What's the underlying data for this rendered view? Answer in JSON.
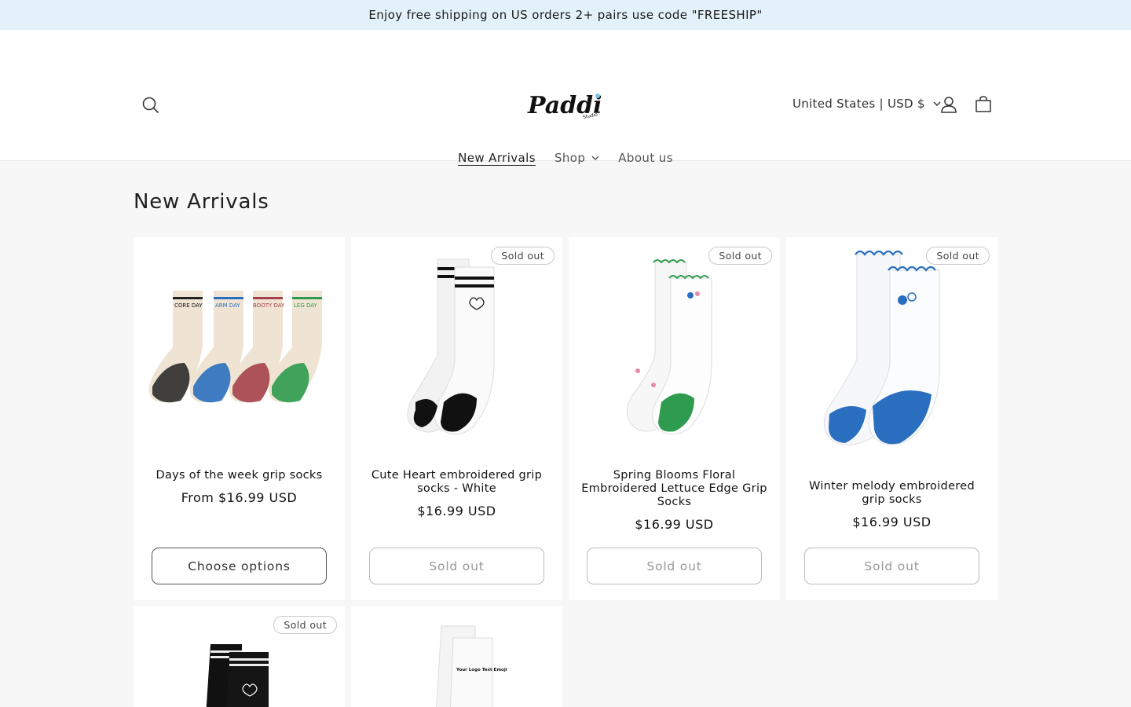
{
  "announcement": "Enjoy free shipping on US orders 2+ pairs use code \"FREESHIP\"",
  "header": {
    "logo_text": "Paddi",
    "logo_sub": "Studio",
    "locale": "United States | USD $"
  },
  "nav": [
    {
      "label": "New Arrivals",
      "active": true
    },
    {
      "label": "Shop",
      "dropdown": true
    },
    {
      "label": "About us"
    }
  ],
  "page_title": "New Arrivals",
  "products": [
    {
      "title": "Days of the week grip socks",
      "price": "From $16.99 USD",
      "button": "Choose options",
      "sold_out": false,
      "badge": ""
    },
    {
      "title": "Cute Heart embroidered grip socks - White",
      "price": "$16.99 USD",
      "button": "Sold out",
      "sold_out": true,
      "badge": "Sold out"
    },
    {
      "title": "Spring Blooms Floral Embroidered Lettuce Edge Grip Socks",
      "price": "$16.99 USD",
      "button": "Sold out",
      "sold_out": true,
      "badge": "Sold out"
    },
    {
      "title": "Winter melody embroidered grip socks",
      "price": "$16.99 USD",
      "button": "Sold out",
      "sold_out": true,
      "badge": "Sold out"
    }
  ],
  "row2": [
    {
      "badge": "Sold out"
    },
    {
      "badge": "",
      "print_text": "Your Logo Text Emoji"
    }
  ],
  "sock_labels": [
    "CORE DAY",
    "ARM DAY",
    "BOOTY DAY",
    "LEG DAY"
  ],
  "colors": {
    "announcement_bg": "#e3f1fb",
    "grip_green": "#2e9b4e",
    "grip_blue": "#2a6fbf",
    "grip_red": "#a5414a"
  }
}
